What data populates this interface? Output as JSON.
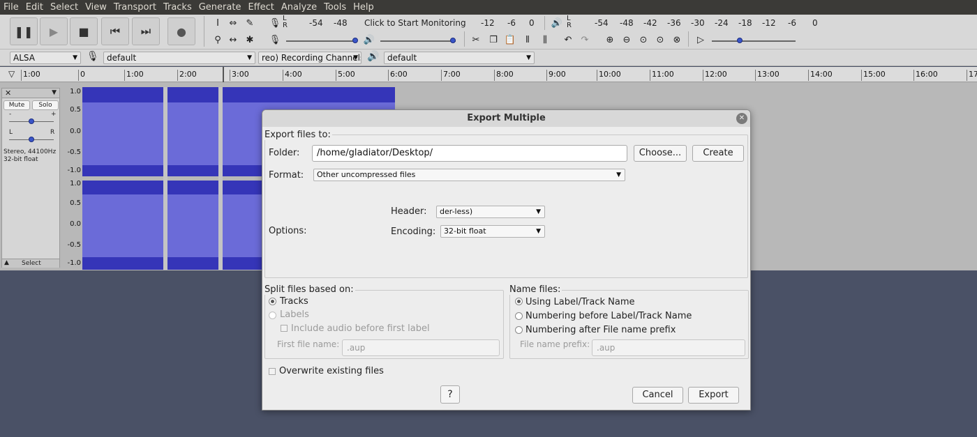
{
  "menu": [
    "File",
    "Edit",
    "Select",
    "View",
    "Transport",
    "Tracks",
    "Generate",
    "Effect",
    "Analyze",
    "Tools",
    "Help"
  ],
  "toolbar": {
    "monitor_text": "Click to Start Monitoring",
    "rec_meter_ticks": [
      "-54",
      "-48",
      "-12",
      "-6",
      "0"
    ],
    "play_meter_ticks": [
      "-54",
      "-48",
      "-42",
      "-36",
      "-30",
      "-24",
      "-18",
      "-12",
      "-6",
      "0"
    ],
    "lr": [
      "L",
      "R"
    ]
  },
  "devices": {
    "host": "ALSA",
    "rec_device": "default",
    "channels": "reo) Recording Channels",
    "play_device": "default"
  },
  "ruler": [
    "1:00",
    "0",
    "1:00",
    "2:00",
    "3:00",
    "4:00",
    "5:00",
    "6:00",
    "7:00",
    "8:00",
    "9:00",
    "10:00",
    "11:00",
    "12:00",
    "13:00",
    "14:00",
    "15:00",
    "16:00",
    "17"
  ],
  "track": {
    "mute": "Mute",
    "solo": "Solo",
    "info1": "Stereo, 44100Hz",
    "info2": "32-bit float",
    "select": "Select",
    "pan_l": "L",
    "pan_r": "R",
    "gain_minus": "-",
    "gain_plus": "+",
    "vruler": [
      "1.0",
      "0.5",
      "0.0",
      "-0.5",
      "-1.0"
    ]
  },
  "dialog": {
    "title": "Export Multiple",
    "export_to_label": "Export files to:",
    "folder_label": "Folder:",
    "folder_value": "/home/gladiator/Desktop/",
    "choose_btn": "Choose...",
    "create_btn": "Create",
    "format_label": "Format:",
    "format_value": "Other uncompressed files",
    "options_label": "Options:",
    "header_label": "Header:",
    "header_value": "der-less)",
    "encoding_label": "Encoding:",
    "encoding_value": "32-bit float",
    "split_label": "Split files based on:",
    "split_tracks": "Tracks",
    "split_labels": "Labels",
    "include_audio": "Include audio before first label",
    "first_file_label": "First file name:",
    "first_file_value": ".aup",
    "name_label": "Name files:",
    "name_using": "Using Label/Track Name",
    "name_numbering_before": "Numbering before Label/Track Name",
    "name_numbering_after": "Numbering after File name prefix",
    "prefix_label": "File name prefix:",
    "prefix_value": ".aup",
    "overwrite": "Overwrite existing files",
    "cancel_btn": "Cancel",
    "export_btn": "Export"
  },
  "colors": {
    "waveform": "#3737c8",
    "background": "#4a5166",
    "menubar": "#3b3a37"
  }
}
